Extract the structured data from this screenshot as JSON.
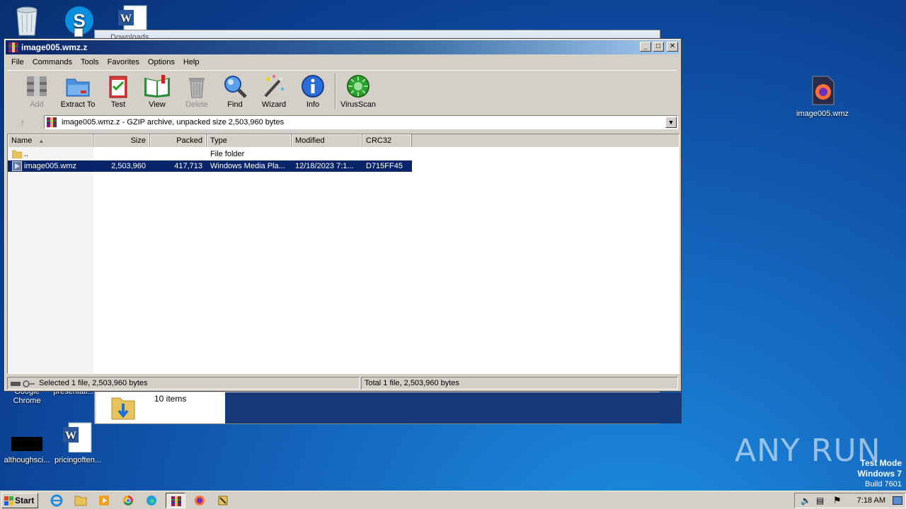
{
  "desktop": {
    "icons": [
      {
        "label": "",
        "icon": "recycle-bin-icon"
      },
      {
        "label": "",
        "icon": "skype-icon"
      },
      {
        "label": "",
        "icon": "word-document-icon"
      },
      {
        "label": "Google Chrome",
        "icon": "chrome-icon"
      },
      {
        "label": "presentati...",
        "icon": "file-icon"
      },
      {
        "label": "althoughsci...",
        "icon": "black-file-icon"
      },
      {
        "label": "pricingoften...",
        "icon": "word-document-icon"
      },
      {
        "label": "image005.wmz",
        "icon": "firefox-icon"
      }
    ]
  },
  "background_window": {
    "title": "Downloads",
    "item_count": "10 items"
  },
  "window": {
    "title": "image005.wmz.z",
    "controls": {
      "minimize": "_",
      "maximize": "□",
      "close": "✕"
    },
    "menu": [
      "File",
      "Commands",
      "Tools",
      "Favorites",
      "Options",
      "Help"
    ],
    "toolbar": [
      {
        "label": "Add",
        "icon": "add-archive-icon",
        "enabled": false
      },
      {
        "label": "Extract To",
        "icon": "extract-folder-icon",
        "enabled": true
      },
      {
        "label": "Test",
        "icon": "test-clipboard-icon",
        "enabled": true
      },
      {
        "label": "View",
        "icon": "view-book-icon",
        "enabled": true
      },
      {
        "label": "Delete",
        "icon": "delete-trash-icon",
        "enabled": false
      },
      {
        "label": "Find",
        "icon": "find-magnifier-icon",
        "enabled": true
      },
      {
        "label": "Wizard",
        "icon": "wizard-wand-icon",
        "enabled": true
      },
      {
        "label": "Info",
        "icon": "info-icon",
        "enabled": true
      },
      {
        "label": "VirusScan",
        "icon": "virusscan-icon",
        "enabled": true
      }
    ],
    "address": "image005.wmz.z - GZIP archive, unpacked size 2,503,960 bytes",
    "columns": [
      "Name",
      "Size",
      "Packed",
      "Type",
      "Modified",
      "CRC32"
    ],
    "rows": [
      {
        "name": "..",
        "size": "",
        "packed": "",
        "type": "File folder",
        "modified": "",
        "crc": "",
        "selected": false
      },
      {
        "name": "image005.wmz",
        "size": "2,503,960",
        "packed": "417,713",
        "type": "Windows Media Pla...",
        "modified": "12/18/2023 7:1...",
        "crc": "D715FF45",
        "selected": true
      }
    ],
    "status_left": "Selected 1 file, 2,503,960 bytes",
    "status_right": "Total 1 file, 2,503,960 bytes"
  },
  "taskbar": {
    "start_label": "Start",
    "clock": "7:18 AM"
  },
  "watermark": "ANY RUN",
  "test_mode": {
    "line1": "Test Mode",
    "line2": "Windows 7",
    "line3": "Build 7601"
  },
  "colors": {
    "accent": "#0a246a",
    "desktop": "#1569c0"
  }
}
